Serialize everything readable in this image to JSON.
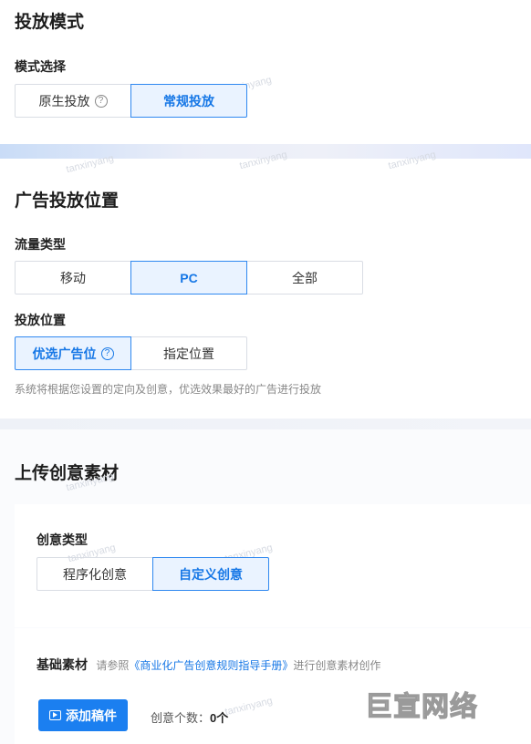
{
  "delivery_mode": {
    "title": "投放模式",
    "mode_label": "模式选择",
    "options": [
      {
        "label": "原生投放",
        "help": "?"
      },
      {
        "label": "常规投放"
      }
    ]
  },
  "ad_position": {
    "title": "广告投放位置",
    "traffic_label": "流量类型",
    "traffic_options": [
      "移动",
      "PC",
      "全部"
    ],
    "position_label": "投放位置",
    "position_options": [
      {
        "label": "优选广告位",
        "help": "?"
      },
      {
        "label": "指定位置"
      }
    ],
    "hint": "系统将根据您设置的定向及创意，优选效果最好的广告进行投放"
  },
  "upload": {
    "title": "上传创意素材",
    "creative_type_label": "创意类型",
    "creative_options": [
      "程序化创意",
      "自定义创意"
    ],
    "basic_label": "基础素材",
    "basic_prefix": "请参照",
    "basic_link": "《商业化广告创意规则指导手册》",
    "basic_suffix": "进行创意素材创作",
    "add_button": "添加稿件",
    "count_label": "创意个数：",
    "count_value": "0个"
  },
  "watermark": "tanxinyang",
  "logo_text": "巨宣网络",
  "colors": {
    "accent": "#1677e6",
    "primary_button": "#1b7ff0"
  }
}
